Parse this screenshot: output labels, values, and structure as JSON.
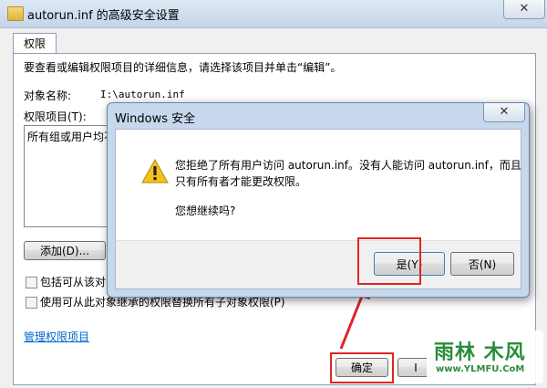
{
  "window": {
    "title": "autorun.inf 的高级安全设置",
    "close_glyph": "✕",
    "tab_label": "权限"
  },
  "panel": {
    "instruction": "要查看或编辑权限项目的详细信息，请选择该项目并单击“编辑”。",
    "object_name_label": "对象名称:",
    "object_name_value": "I:\\autorun.inf",
    "entries_label": "权限项目(T):",
    "list_first_row": "所有组或用户均不",
    "add_button": "添加(D)...",
    "checkbox_inherit_label": "包括可从该对象",
    "checkbox_replace_label": "使用可从此对象继承的权限替换所有子对象权限(P)",
    "manage_link": "管理权限项目",
    "ok_button": "确定",
    "partial_button": "I"
  },
  "warning_dialog": {
    "title": "Windows 安全",
    "close_glyph": "✕",
    "message_line1": "您拒绝了所有用户访问 autorun.inf。没有人能访问 autorun.inf，而且",
    "message_line2": "只有所有者才能更改权限。",
    "question": "您想继续吗?",
    "yes_button": "是(Y)",
    "no_button": "否(N)"
  },
  "watermark": {
    "logo_text": "雨林 木风",
    "url": "www.YLMFU.CoM"
  },
  "colors": {
    "highlight": "#e02424",
    "link": "#0066cc"
  }
}
